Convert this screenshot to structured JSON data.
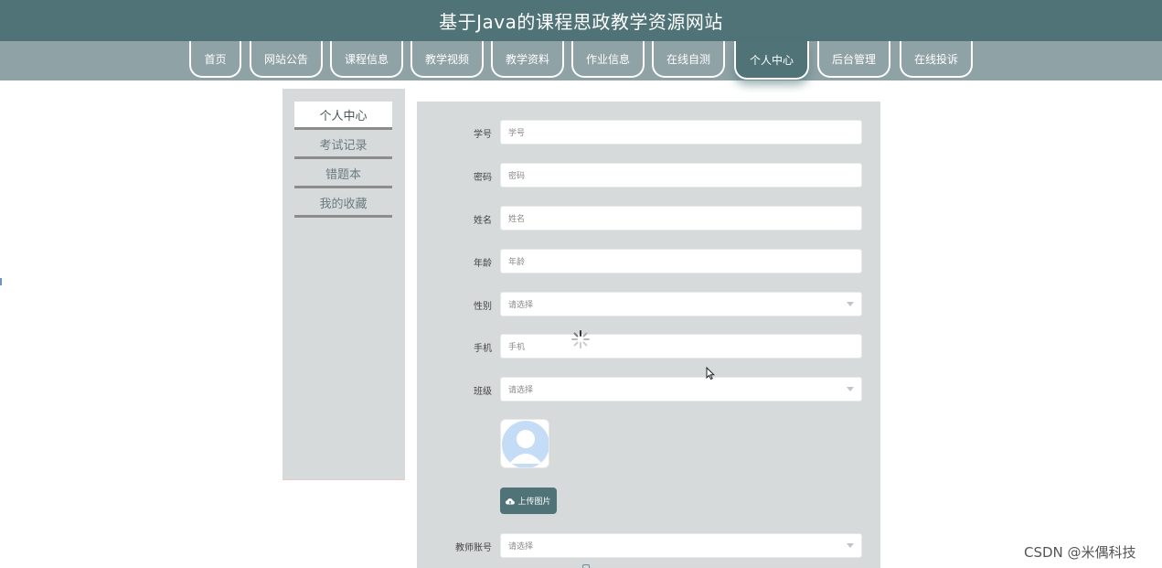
{
  "header": {
    "title": "基于Java的课程思政教学资源网站"
  },
  "nav": {
    "items": [
      {
        "label": "首页"
      },
      {
        "label": "网站公告"
      },
      {
        "label": "课程信息"
      },
      {
        "label": "教学视频"
      },
      {
        "label": "教学资料"
      },
      {
        "label": "作业信息"
      },
      {
        "label": "在线自测"
      },
      {
        "label": "个人中心"
      },
      {
        "label": "后台管理"
      },
      {
        "label": "在线投诉"
      }
    ],
    "active": "个人中心"
  },
  "sidebar": {
    "items": [
      {
        "label": "个人中心"
      },
      {
        "label": "考试记录"
      },
      {
        "label": "错题本"
      },
      {
        "label": "我的收藏"
      }
    ]
  },
  "form": {
    "fields": [
      {
        "label": "学号",
        "placeholder": "学号",
        "type": "text"
      },
      {
        "label": "密码",
        "placeholder": "密码",
        "type": "text"
      },
      {
        "label": "姓名",
        "placeholder": "姓名",
        "type": "text"
      },
      {
        "label": "年龄",
        "placeholder": "年龄",
        "type": "text"
      },
      {
        "label": "性别",
        "placeholder": "请选择",
        "type": "select"
      },
      {
        "label": "手机",
        "placeholder": "手机",
        "type": "text"
      },
      {
        "label": "班级",
        "placeholder": "请选择",
        "type": "select"
      },
      {
        "label": "教师账号",
        "placeholder": "请选择",
        "type": "select"
      }
    ],
    "upload_label": "上传图片"
  },
  "colors": {
    "primary": "#4f7377",
    "nav_bar": "#8fa2a6",
    "panel": "#d6dadb"
  },
  "watermark": "CSDN @米偶科技"
}
